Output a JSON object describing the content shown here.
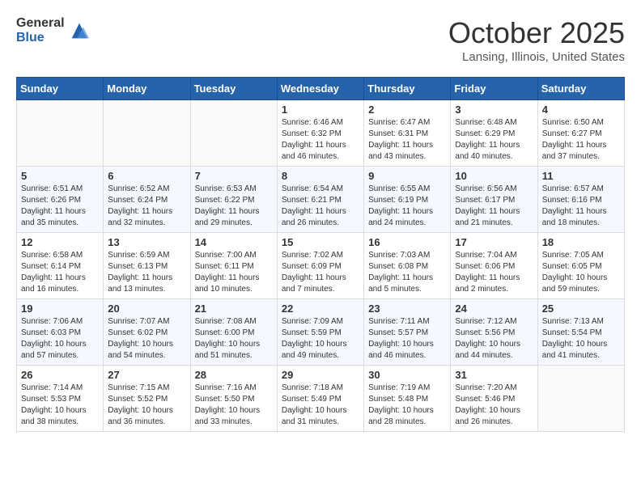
{
  "logo": {
    "general": "General",
    "blue": "Blue"
  },
  "title": "October 2025",
  "location": "Lansing, Illinois, United States",
  "headers": [
    "Sunday",
    "Monday",
    "Tuesday",
    "Wednesday",
    "Thursday",
    "Friday",
    "Saturday"
  ],
  "weeks": [
    [
      {
        "day": "",
        "info": ""
      },
      {
        "day": "",
        "info": ""
      },
      {
        "day": "",
        "info": ""
      },
      {
        "day": "1",
        "info": "Sunrise: 6:46 AM\nSunset: 6:32 PM\nDaylight: 11 hours and 46 minutes."
      },
      {
        "day": "2",
        "info": "Sunrise: 6:47 AM\nSunset: 6:31 PM\nDaylight: 11 hours and 43 minutes."
      },
      {
        "day": "3",
        "info": "Sunrise: 6:48 AM\nSunset: 6:29 PM\nDaylight: 11 hours and 40 minutes."
      },
      {
        "day": "4",
        "info": "Sunrise: 6:50 AM\nSunset: 6:27 PM\nDaylight: 11 hours and 37 minutes."
      }
    ],
    [
      {
        "day": "5",
        "info": "Sunrise: 6:51 AM\nSunset: 6:26 PM\nDaylight: 11 hours and 35 minutes."
      },
      {
        "day": "6",
        "info": "Sunrise: 6:52 AM\nSunset: 6:24 PM\nDaylight: 11 hours and 32 minutes."
      },
      {
        "day": "7",
        "info": "Sunrise: 6:53 AM\nSunset: 6:22 PM\nDaylight: 11 hours and 29 minutes."
      },
      {
        "day": "8",
        "info": "Sunrise: 6:54 AM\nSunset: 6:21 PM\nDaylight: 11 hours and 26 minutes."
      },
      {
        "day": "9",
        "info": "Sunrise: 6:55 AM\nSunset: 6:19 PM\nDaylight: 11 hours and 24 minutes."
      },
      {
        "day": "10",
        "info": "Sunrise: 6:56 AM\nSunset: 6:17 PM\nDaylight: 11 hours and 21 minutes."
      },
      {
        "day": "11",
        "info": "Sunrise: 6:57 AM\nSunset: 6:16 PM\nDaylight: 11 hours and 18 minutes."
      }
    ],
    [
      {
        "day": "12",
        "info": "Sunrise: 6:58 AM\nSunset: 6:14 PM\nDaylight: 11 hours and 16 minutes."
      },
      {
        "day": "13",
        "info": "Sunrise: 6:59 AM\nSunset: 6:13 PM\nDaylight: 11 hours and 13 minutes."
      },
      {
        "day": "14",
        "info": "Sunrise: 7:00 AM\nSunset: 6:11 PM\nDaylight: 11 hours and 10 minutes."
      },
      {
        "day": "15",
        "info": "Sunrise: 7:02 AM\nSunset: 6:09 PM\nDaylight: 11 hours and 7 minutes."
      },
      {
        "day": "16",
        "info": "Sunrise: 7:03 AM\nSunset: 6:08 PM\nDaylight: 11 hours and 5 minutes."
      },
      {
        "day": "17",
        "info": "Sunrise: 7:04 AM\nSunset: 6:06 PM\nDaylight: 11 hours and 2 minutes."
      },
      {
        "day": "18",
        "info": "Sunrise: 7:05 AM\nSunset: 6:05 PM\nDaylight: 10 hours and 59 minutes."
      }
    ],
    [
      {
        "day": "19",
        "info": "Sunrise: 7:06 AM\nSunset: 6:03 PM\nDaylight: 10 hours and 57 minutes."
      },
      {
        "day": "20",
        "info": "Sunrise: 7:07 AM\nSunset: 6:02 PM\nDaylight: 10 hours and 54 minutes."
      },
      {
        "day": "21",
        "info": "Sunrise: 7:08 AM\nSunset: 6:00 PM\nDaylight: 10 hours and 51 minutes."
      },
      {
        "day": "22",
        "info": "Sunrise: 7:09 AM\nSunset: 5:59 PM\nDaylight: 10 hours and 49 minutes."
      },
      {
        "day": "23",
        "info": "Sunrise: 7:11 AM\nSunset: 5:57 PM\nDaylight: 10 hours and 46 minutes."
      },
      {
        "day": "24",
        "info": "Sunrise: 7:12 AM\nSunset: 5:56 PM\nDaylight: 10 hours and 44 minutes."
      },
      {
        "day": "25",
        "info": "Sunrise: 7:13 AM\nSunset: 5:54 PM\nDaylight: 10 hours and 41 minutes."
      }
    ],
    [
      {
        "day": "26",
        "info": "Sunrise: 7:14 AM\nSunset: 5:53 PM\nDaylight: 10 hours and 38 minutes."
      },
      {
        "day": "27",
        "info": "Sunrise: 7:15 AM\nSunset: 5:52 PM\nDaylight: 10 hours and 36 minutes."
      },
      {
        "day": "28",
        "info": "Sunrise: 7:16 AM\nSunset: 5:50 PM\nDaylight: 10 hours and 33 minutes."
      },
      {
        "day": "29",
        "info": "Sunrise: 7:18 AM\nSunset: 5:49 PM\nDaylight: 10 hours and 31 minutes."
      },
      {
        "day": "30",
        "info": "Sunrise: 7:19 AM\nSunset: 5:48 PM\nDaylight: 10 hours and 28 minutes."
      },
      {
        "day": "31",
        "info": "Sunrise: 7:20 AM\nSunset: 5:46 PM\nDaylight: 10 hours and 26 minutes."
      },
      {
        "day": "",
        "info": ""
      }
    ]
  ]
}
